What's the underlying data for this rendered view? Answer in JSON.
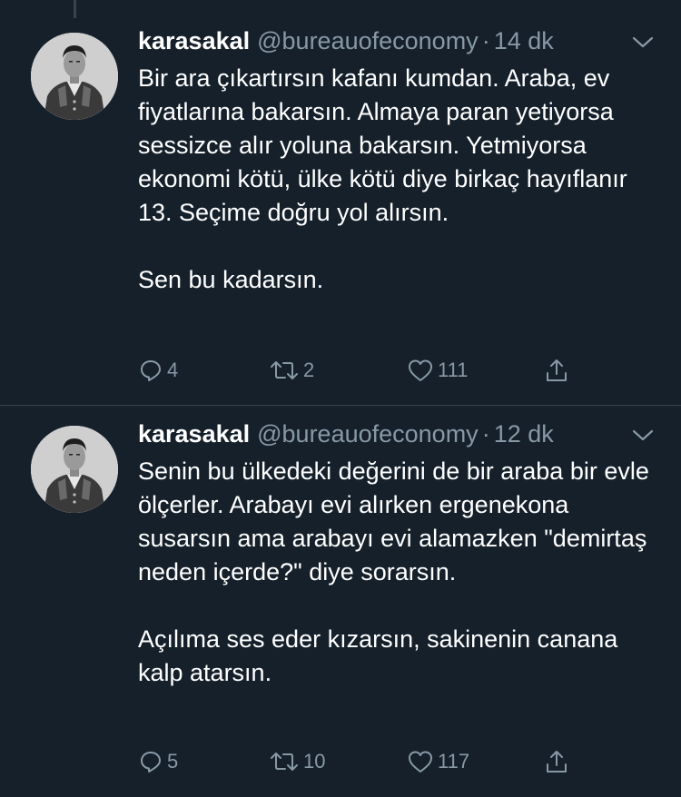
{
  "tweets": [
    {
      "display_name": "karasakal",
      "handle": "@bureauofeconomy",
      "separator": "·",
      "time": "14 dk",
      "paragraphs": [
        "Bir ara çıkartırsın kafanı kumdan. Araba, ev fiyatlarına bakarsın. Almaya paran yetiyorsa sessizce alır yoluna bakarsın. Yetmiyorsa ekonomi kötü, ülke kötü diye birkaç hayıflanır 13. Seçime doğru yol alırsın.",
        "Sen bu kadarsın."
      ],
      "replies": "4",
      "retweets": "2",
      "likes": "111"
    },
    {
      "display_name": "karasakal",
      "handle": "@bureauofeconomy",
      "separator": "·",
      "time": "12 dk",
      "paragraphs": [
        "Senin bu ülkedeki değerini de bir araba bir evle ölçerler. Arabayı evi alırken ergenekona susarsın ama arabayı evi alamazken \"demirtaş neden içerde?\" diye sorarsın.",
        "Açılıma ses eder kızarsın, sakinenin canana kalp atarsın."
      ],
      "replies": "5",
      "retweets": "10",
      "likes": "117"
    }
  ],
  "colors": {
    "background": "#15202b",
    "text": "#ffffff",
    "secondary": "#8899a6",
    "divider": "#38444d"
  },
  "icons": {
    "reply": "reply-icon",
    "retweet": "retweet-icon",
    "like": "heart-icon",
    "share": "share-icon",
    "menu": "chevron-down-icon"
  }
}
